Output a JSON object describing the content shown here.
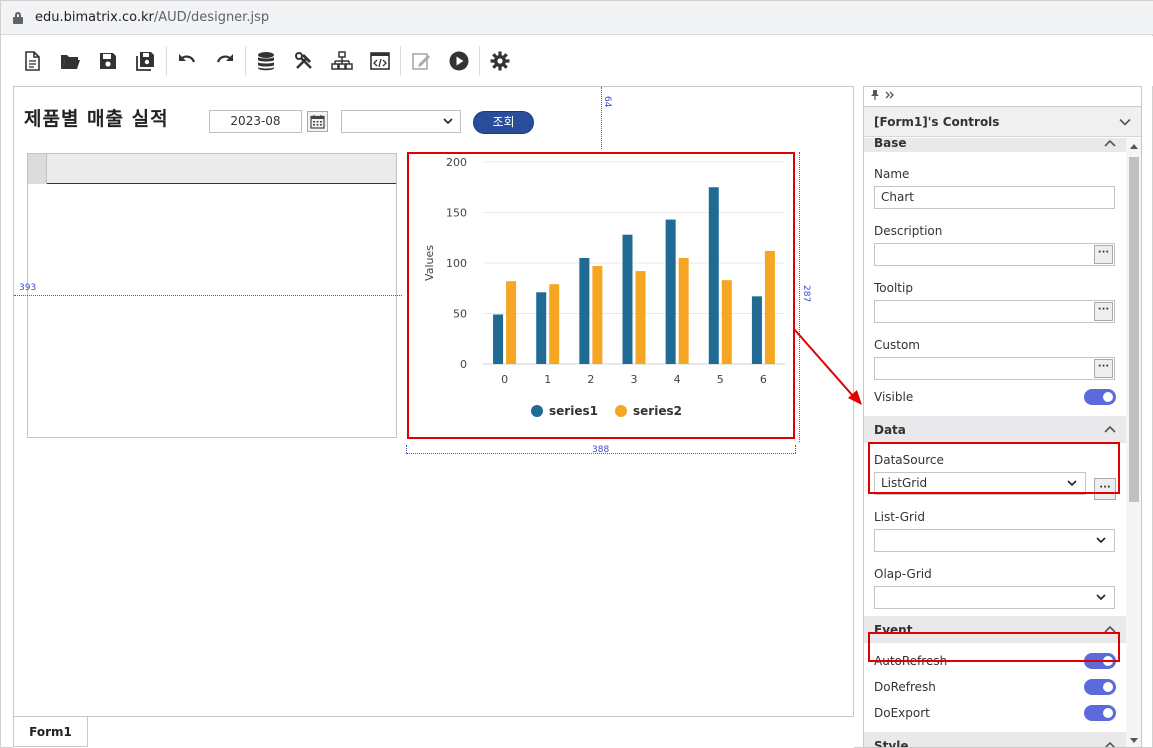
{
  "browser": {
    "url_host": "edu.bimatrix.co.kr",
    "url_path": "/AUD/designer.jsp"
  },
  "toolbar": {
    "buttons": [
      "new-document-icon",
      "open-folder-icon",
      "save-icon",
      "save-all-icon",
      "undo-icon",
      "redo-icon",
      "database-icon",
      "tools-icon",
      "hierarchy-icon",
      "script-editor-icon",
      "edit-icon",
      "run-icon",
      "settings-icon"
    ]
  },
  "form": {
    "title": "제품별 매출 실적",
    "date_value": "2023-08",
    "select_value": "",
    "query_button": "조회",
    "guide_left_label": "393",
    "guide_top_label": "64",
    "guide_right_label": "287",
    "guide_bottom_label": "388"
  },
  "chart_data": {
    "type": "bar",
    "categories": [
      "0",
      "1",
      "2",
      "3",
      "4",
      "5",
      "6"
    ],
    "series": [
      {
        "name": "series1",
        "color": "#1f6b94",
        "values": [
          49,
          71,
          105,
          128,
          143,
          175,
          67
        ]
      },
      {
        "name": "series2",
        "color": "#f5a623",
        "values": [
          82,
          79,
          97,
          92,
          105,
          83,
          112
        ]
      }
    ],
    "ylabel": "Values",
    "yticks": [
      "0",
      "50",
      "100",
      "150",
      "200"
    ],
    "ylim": [
      0,
      200
    ],
    "grid": true,
    "legend_position": "bottom"
  },
  "tabs": {
    "form_tab": "Form1"
  },
  "panel": {
    "header": "[Form1]'s Controls",
    "sections": {
      "base": "Base",
      "data": "Data",
      "event": "Event",
      "style": "Style"
    },
    "props": {
      "name_label": "Name",
      "name_value": "Chart",
      "description_label": "Description",
      "tooltip_label": "Tooltip",
      "custom_label": "Custom",
      "visible_label": "Visible",
      "datasource_label": "DataSource",
      "datasource_value": "ListGrid",
      "listgrid_label": "List-Grid",
      "olapgrid_label": "Olap-Grid",
      "autorefresh_label": "AutoRefresh",
      "dorefresh_label": "DoRefresh",
      "doexport_label": "DoExport",
      "dots": "···"
    },
    "colors": {
      "accent_red": "#e00000",
      "toggle_on": "#5c6bdc"
    }
  }
}
